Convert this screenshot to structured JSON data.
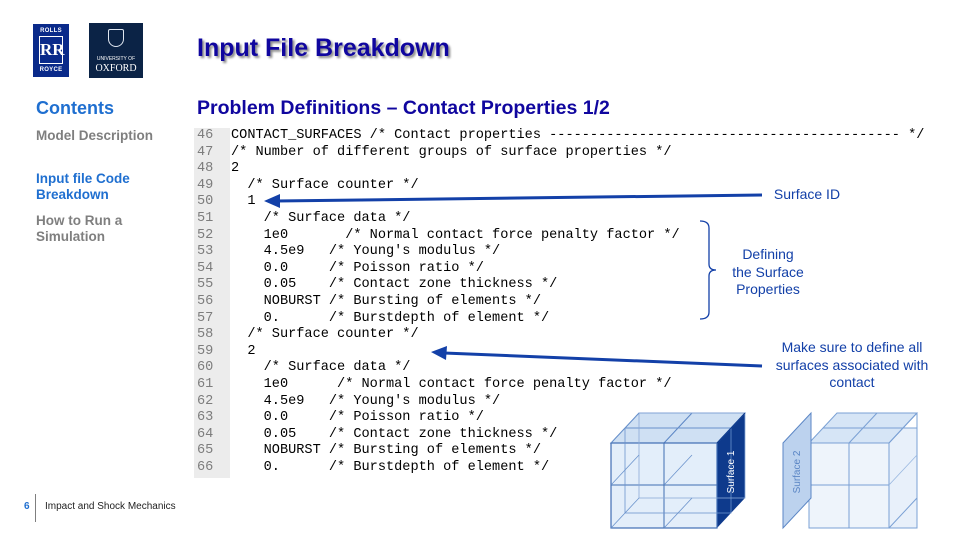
{
  "logos": {
    "rr_top": "ROLLS",
    "rr_mid": "RR",
    "rr_bottom": "ROYCE",
    "oxford_small": "UNIVERSITY OF",
    "oxford_big": "OXFORD"
  },
  "title": "Input File Breakdown",
  "sidebar": {
    "heading": "Contents",
    "items": [
      {
        "label": "Model Description"
      },
      {
        "label": "Input file Code Breakdown"
      },
      {
        "label": "How to Run a Simulation"
      }
    ]
  },
  "subtitle": "Problem Definitions – Contact Properties 1/2",
  "code_lines": [
    {
      "num": "46",
      "text": "CONTACT_SURFACES /* Contact properties ------------------------------------------- */"
    },
    {
      "num": "47",
      "text": "/* Number of different groups of surface properties */"
    },
    {
      "num": "48",
      "text": "2"
    },
    {
      "num": "49",
      "text": "  /* Surface counter */"
    },
    {
      "num": "50",
      "text": "  1"
    },
    {
      "num": "51",
      "text": "    /* Surface data */"
    },
    {
      "num": "52",
      "text": "    1e0       /* Normal contact force penalty factor */"
    },
    {
      "num": "53",
      "text": "    4.5e9   /* Young's modulus */"
    },
    {
      "num": "54",
      "text": "    0.0     /* Poisson ratio */"
    },
    {
      "num": "55",
      "text": "    0.05    /* Contact zone thickness */"
    },
    {
      "num": "56",
      "text": "    NOBURST /* Bursting of elements */"
    },
    {
      "num": "57",
      "text": "    0.      /* Burstdepth of element */"
    },
    {
      "num": "58",
      "text": "  /* Surface counter */"
    },
    {
      "num": "59",
      "text": "  2"
    },
    {
      "num": "60",
      "text": "    /* Surface data */"
    },
    {
      "num": "61",
      "text": "    1e0      /* Normal contact force penalty factor */"
    },
    {
      "num": "62",
      "text": "    4.5e9   /* Young's modulus */"
    },
    {
      "num": "63",
      "text": "    0.0     /* Poisson ratio */"
    },
    {
      "num": "64",
      "text": "    0.05    /* Contact zone thickness */"
    },
    {
      "num": "65",
      "text": "    NOBURST /* Bursting of elements */"
    },
    {
      "num": "66",
      "text": "    0.      /* Burstdepth of element */"
    }
  ],
  "annotations": {
    "surface_id": "Surface ID",
    "defining": [
      "Defining",
      "the Surface",
      "Properties"
    ],
    "make_sure": [
      "Make sure to define all",
      "surfaces associated with",
      "contact"
    ]
  },
  "figure": {
    "surface1_label": "Surface 1",
    "surface2_label": "Surface 2"
  },
  "colors": {
    "title": "#10069f",
    "accent": "#1f6fd0",
    "annotation": "#1340a8",
    "cube_dark": "#0e3a8c"
  },
  "footer": {
    "page_number": "6",
    "text": "Impact and Shock Mechanics"
  }
}
